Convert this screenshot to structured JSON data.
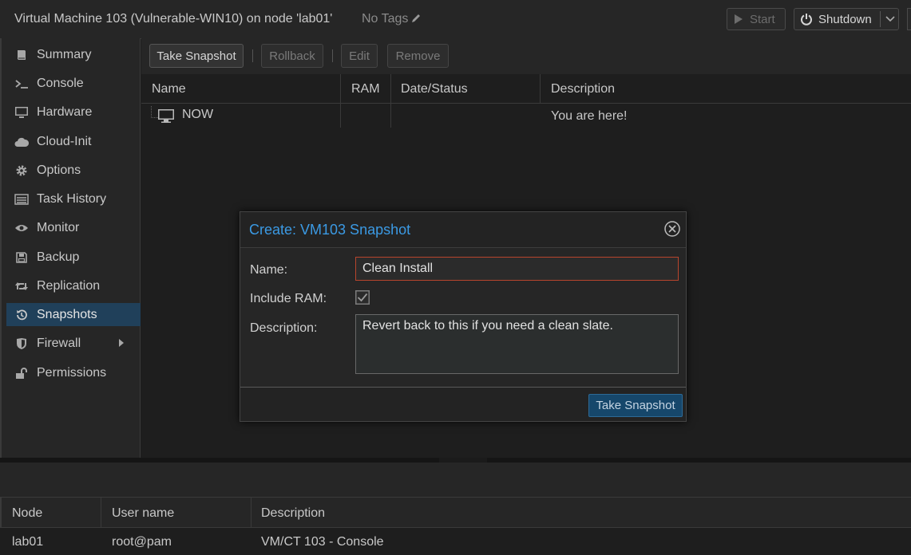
{
  "header": {
    "vm_title": "Virtual Machine 103 (Vulnerable-WIN10) on node 'lab01'",
    "tags_label": "No Tags",
    "start_label": "Start",
    "shutdown_label": "Shutdown"
  },
  "sidebar": {
    "items": [
      {
        "label": "Summary",
        "icon": "book-icon"
      },
      {
        "label": "Console",
        "icon": "terminal-icon"
      },
      {
        "label": "Hardware",
        "icon": "desktop-icon"
      },
      {
        "label": "Cloud-Init",
        "icon": "cloud-icon"
      },
      {
        "label": "Options",
        "icon": "gear-icon"
      },
      {
        "label": "Task History",
        "icon": "list-icon"
      },
      {
        "label": "Monitor",
        "icon": "eye-icon"
      },
      {
        "label": "Backup",
        "icon": "floppy-icon"
      },
      {
        "label": "Replication",
        "icon": "retweet-icon"
      },
      {
        "label": "Snapshots",
        "icon": "history-icon"
      },
      {
        "label": "Firewall",
        "icon": "shield-icon"
      },
      {
        "label": "Permissions",
        "icon": "unlock-icon"
      }
    ],
    "active": "Snapshots"
  },
  "toolbar": {
    "take_snapshot": "Take Snapshot",
    "rollback": "Rollback",
    "edit": "Edit",
    "remove": "Remove"
  },
  "grid": {
    "columns": [
      "Name",
      "RAM",
      "Date/Status",
      "Description"
    ],
    "rows": [
      {
        "name": "NOW",
        "ram": "",
        "date_status": "",
        "description": "You are here!"
      }
    ]
  },
  "dialog": {
    "title": "Create: VM103 Snapshot",
    "name_label": "Name:",
    "name_value": "Clean Install",
    "include_ram_label": "Include RAM:",
    "include_ram_checked": true,
    "description_label": "Description:",
    "description_value": "Revert back to this if you need a clean slate.",
    "submit_label": "Take Snapshot"
  },
  "tasks": {
    "columns": [
      "Node",
      "User name",
      "Description"
    ],
    "rows": [
      {
        "node": "lab01",
        "user": "root@pam",
        "description": "VM/CT 103 - Console"
      }
    ]
  },
  "colors": {
    "accent": "#3b9ae4",
    "active_nav": "#20405a",
    "invalid_border": "#b8452d",
    "primary_button": "#16476b"
  }
}
